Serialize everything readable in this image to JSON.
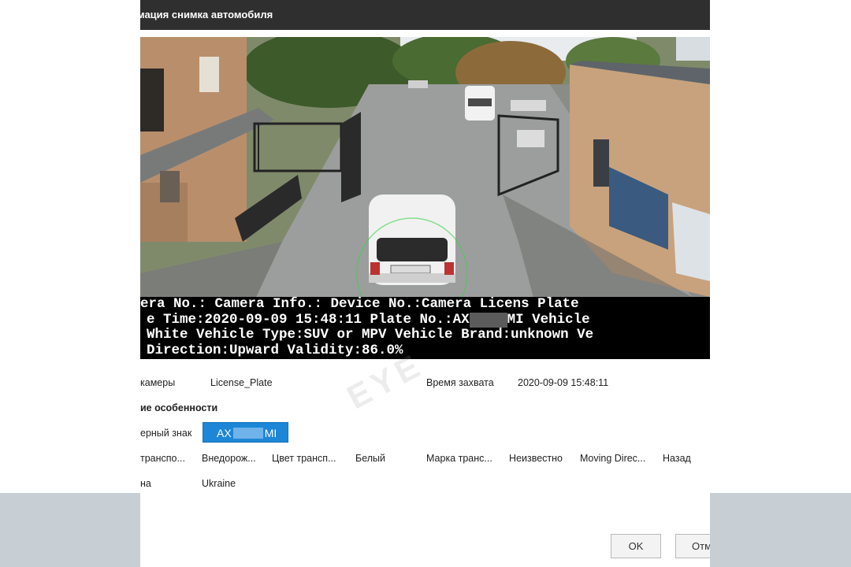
{
  "dialog": {
    "title": "мация снимка автомобиля"
  },
  "osd": {
    "lines": [
      "era No.: Camera Info.: Device No.:Camera Licens Plate",
      "e Time:2020-09-09 15:48:11 Plate No.:AX",
      "MI Vehicle",
      "White Vehicle Type:SUV or MPV Vehicle Brand:unknown Ve",
      "Direction:Upward Validity:86.0%"
    ]
  },
  "info": {
    "camera_label": "камеры",
    "camera_value": "License_Plate",
    "capture_time_label": "Время захвата",
    "capture_time_value": "2020-09-09 15:48:11",
    "section_title": "ие особенности",
    "plate_label": "ерный знак",
    "plate_prefix": "AX",
    "plate_suffix": "MI",
    "vehicle_type_label": "транспо...",
    "vehicle_type_value": "Внедорож...",
    "vehicle_color_label": "Цвет трансп...",
    "vehicle_color_value": "Белый",
    "brand_label": "Марка транс...",
    "brand_value": "Неизвестно",
    "direction_label": "Moving Direc...",
    "direction_value": "Назад",
    "country_label": "на",
    "country_value": "Ukraine"
  },
  "buttons": {
    "ok": "OK",
    "cancel": "Отм"
  },
  "watermark": "EYE"
}
